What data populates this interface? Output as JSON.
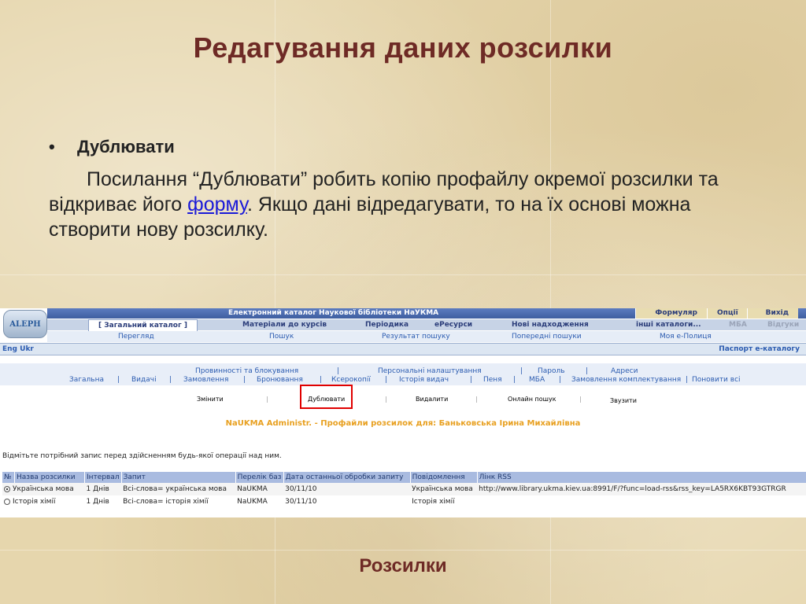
{
  "slide": {
    "title": "Редагування даних розсилки",
    "bullet_marker": "•",
    "bullet": "Дублювати",
    "para_part1": "Посилання “Дублювати” робить копію профайлу окремої розсилки та відкриває його ",
    "para_link": "форму",
    "para_part2": ". Якщо дані відредагувати, то на їх основі можна створити нову розсилку.",
    "caption": "Розсилки"
  },
  "aleph": {
    "logo": "ALEPH",
    "catalog_title": "Електронний каталог Наукової бібліотеки НаУКМА",
    "top_links": [
      "Формуляр",
      "Опції",
      "Вихід"
    ],
    "tabs": [
      "[ Загальний каталог ]",
      "Матеріали до курсів",
      "Періодика",
      "еРесурси",
      "Нові надходження",
      "інші каталоги...",
      "МБА",
      "Відгуки"
    ],
    "subnav": [
      "Перегляд",
      "Пошук",
      "Результат пошуку",
      "Попередні пошуки",
      "Моя е-Полиця"
    ],
    "lang": "Eng Ukr",
    "passport": "Паспорт е-каталогу",
    "menu_row1": [
      "Провинності та блокування",
      "|",
      "Персональні налаштування",
      "|",
      "Пароль",
      "|",
      "Адреси"
    ],
    "menu_row2": [
      "Загальна",
      "|",
      "Видачі",
      "|",
      "Замовлення",
      "|",
      "Бронювання",
      "|",
      "Ксерокопії",
      "|",
      "Історія видач",
      "|",
      "Пеня",
      "|",
      "МБА",
      "|",
      "Замовлення комплектування",
      "|",
      "Поновити всі"
    ],
    "actions": {
      "change": "Змінити",
      "duplicate": "Дублювати",
      "delete": "Видалити",
      "online_search": "Онлайн пошук",
      "reports": "Звузити",
      "sep": "|"
    },
    "profile_heading": "NaUKMA Administr. - Профайли розсилок для: Баньковська Ірина Михайлівна",
    "hint": "Відмітьте потрібний запис перед здійсненням будь-якої операції над ним.",
    "table": {
      "columns": [
        "№",
        "Назва розсилки",
        "Інтервал",
        "Запит",
        "Перелік баз",
        "Дата останньої обробки запиту",
        "Повідомлення",
        "Лінк RSS"
      ],
      "rows": [
        [
          "Українська мова",
          "1 Днів",
          "Всі-слова= українська мова",
          "NaUKMA",
          "30/11/10",
          "Українська мова",
          "http://www.library.ukma.kiev.ua:8991/F/?func=load-rss&rss_key=LA5RX6KBT93GTRGR"
        ],
        [
          "Історія хімії",
          "1 Днів",
          "Всі-слова= історія хімії",
          "NaUKMA",
          "30/11/10",
          "Історія хімії",
          ""
        ]
      ],
      "selected_row": 0
    }
  }
}
